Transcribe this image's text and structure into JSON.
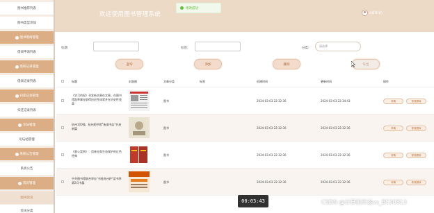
{
  "app": {
    "title": "欢迎使用图书管理系统",
    "user": "admin",
    "toast": "修改成功"
  },
  "sidebar": {
    "items": [
      {
        "label": "图书推荐列表",
        "kind": "item"
      },
      {
        "label": "图书类型添加",
        "kind": "item"
      },
      {
        "label": "图书借阅管理",
        "kind": "group"
      },
      {
        "label": "借阅申请列表",
        "kind": "item"
      },
      {
        "label": "借阅记录管理",
        "kind": "group"
      },
      {
        "label": "借阅记录列表",
        "kind": "item"
      },
      {
        "label": "归还记录管理",
        "kind": "group"
      },
      {
        "label": "归还记录列表",
        "kind": "item"
      },
      {
        "label": "论坛管理",
        "kind": "group"
      },
      {
        "label": "论坛帖管理",
        "kind": "item"
      },
      {
        "label": "系统公告管理",
        "kind": "group"
      },
      {
        "label": "系统公告",
        "kind": "item"
      },
      {
        "label": "资讯管理",
        "kind": "group"
      },
      {
        "label": "图书资讯",
        "kind": "active"
      },
      {
        "label": "资讯分类",
        "kind": "item"
      }
    ]
  },
  "filters": {
    "title_label": "标题:",
    "tag_label": "标签:",
    "type_label": "分类:",
    "type_placeholder": "请选择"
  },
  "toolbar": {
    "search": "查询",
    "add": "添加",
    "delete": "删除",
    "export": "导出"
  },
  "table": {
    "headers": [
      "标题",
      "封面图",
      "文章分类",
      "标签",
      "创建时间",
      "更新时间",
      "操作"
    ],
    "rows": [
      {
        "title": "《学习的权》刊发新文章在文章，在图书馆起草事业取得历史性成就并在历史性变革",
        "category": "图书",
        "tag": "",
        "created": "2024-03-03 22:32:36",
        "updated": "2024-03-03 22:34:43"
      },
      {
        "title": "杭州100强，杭州图书馆\"街道书店\"开启新篇",
        "category": "图书",
        "tag": "",
        "created": "2024-03-03 22:32:36",
        "updated": "2024-03-03 22:32:36"
      },
      {
        "title": "《意公案例》：用林业和生态保护的红色经典",
        "category": "图书",
        "tag": "",
        "created": "2024-03-03 22:32:36",
        "updated": "2024-03-03 22:32:36"
      },
      {
        "title": "中共图书馆联合举办\"书香苏州杯\"读书季第2月书展",
        "category": "图书",
        "tag": "",
        "created": "2024-03-03 22:32:36",
        "updated": "2024-03-03 22:32:36"
      }
    ],
    "op_detail": "详情",
    "op_edit": "修改删除"
  },
  "overlay": {
    "timer": "00:03:43",
    "watermark": "CSDN @计算机毕设vx_B530813"
  },
  "colors": {
    "accent": "#dcae85",
    "header_bg": "#ecd9c6",
    "button_text": "#b56e40",
    "success": "#67c23a"
  }
}
